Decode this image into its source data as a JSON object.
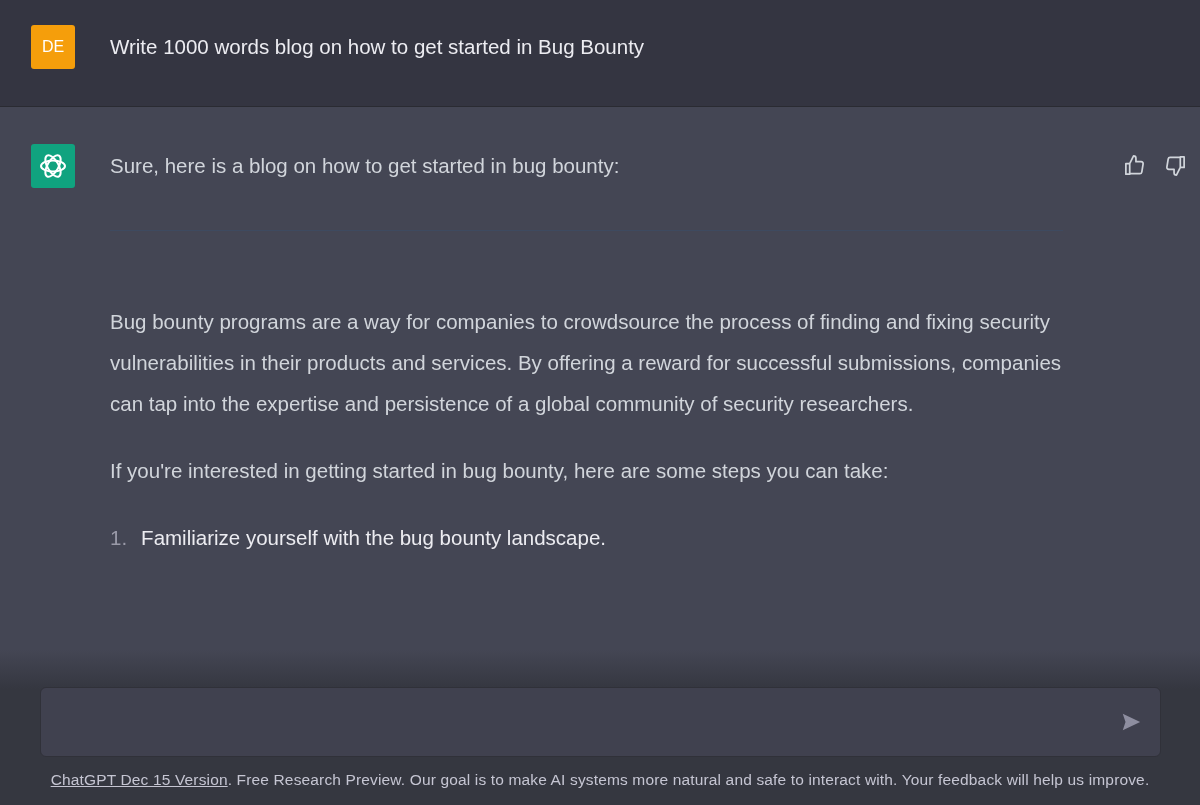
{
  "user_message": {
    "avatar_initials": "DE",
    "text": "Write 1000 words blog on how to get started in Bug Bounty"
  },
  "assistant_message": {
    "intro": "Sure, here is a blog on how to get started in bug bounty:",
    "paragraphs": [
      "Bug bounty programs are a way for companies to crowdsource the process of finding and fixing security vulnerabilities in their products and services. By offering a reward for successful submissions, companies can tap into the expertise and persistence of a global community of security researchers.",
      "If you're interested in getting started in bug bounty, here are some steps you can take:"
    ],
    "steps": [
      {
        "number": "1.",
        "text": "Familiarize yourself with the bug bounty landscape."
      }
    ]
  },
  "footer": {
    "link": "ChatGPT Dec 15 Version",
    "text": ". Free Research Preview. Our goal is to make AI systems more natural and safe to interact with. Your feedback will help us improve."
  }
}
